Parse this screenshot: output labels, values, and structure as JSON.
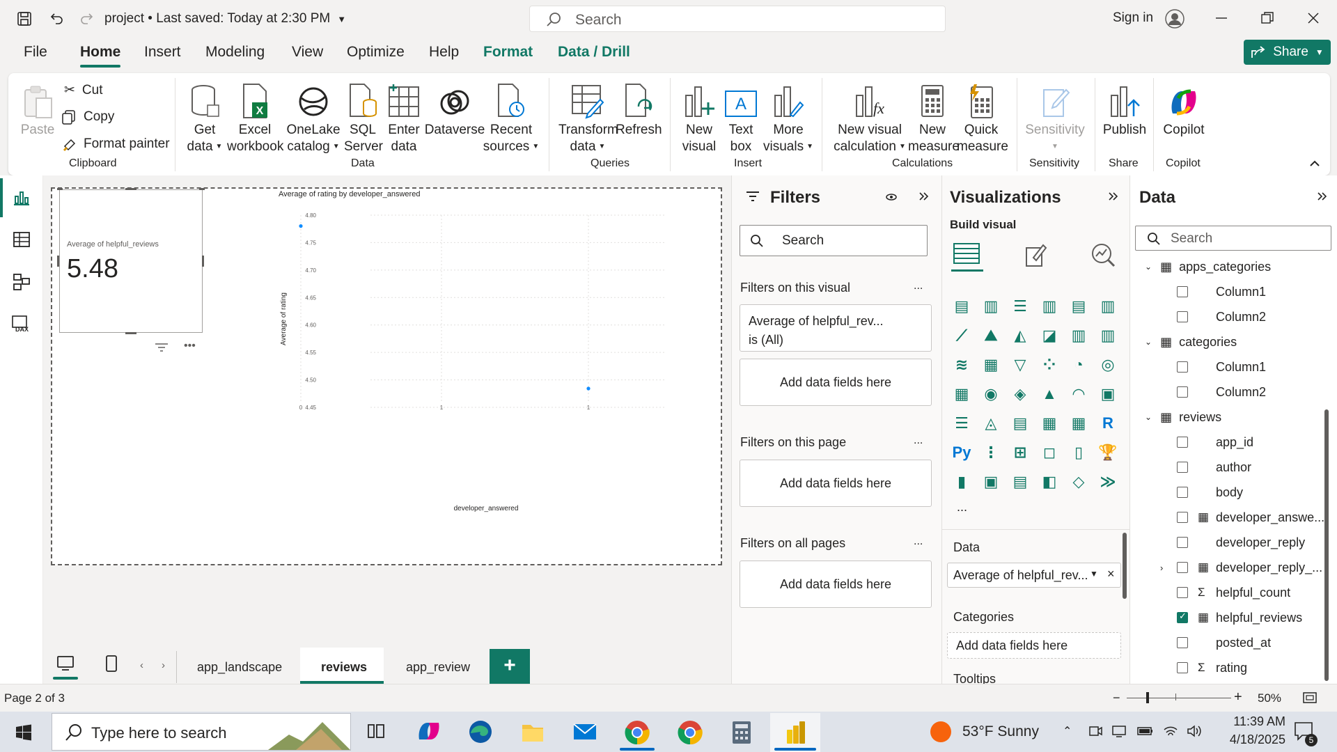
{
  "titlebar": {
    "doc_title": "project • Last saved: Today at 2:30 PM",
    "search_placeholder": "Search",
    "sign_in": "Sign in"
  },
  "menu": {
    "tabs": [
      "File",
      "Home",
      "Insert",
      "Modeling",
      "View",
      "Optimize",
      "Help",
      "Format",
      "Data / Drill"
    ],
    "share": "Share"
  },
  "ribbon": {
    "clipboard": {
      "paste": "Paste",
      "cut": "Cut",
      "copy": "Copy",
      "format_painter": "Format painter",
      "label": "Clipboard"
    },
    "data": {
      "get_data": [
        "Get",
        "data"
      ],
      "excel": [
        "Excel",
        "workbook"
      ],
      "onelake": [
        "OneLake",
        "catalog"
      ],
      "sql": [
        "SQL",
        "Server"
      ],
      "enter": [
        "Enter",
        "data"
      ],
      "dataverse": "Dataverse",
      "recent": [
        "Recent",
        "sources"
      ],
      "label": "Data"
    },
    "queries": {
      "transform": [
        "Transform",
        "data"
      ],
      "refresh": "Refresh",
      "label": "Queries"
    },
    "insert": {
      "new_visual": [
        "New",
        "visual"
      ],
      "text_box": [
        "Text",
        "box"
      ],
      "more_visuals": [
        "More",
        "visuals"
      ],
      "label": "Insert"
    },
    "calculations": {
      "new_visual_calc": [
        "New visual",
        "calculation"
      ],
      "new_measure": [
        "New",
        "measure"
      ],
      "quick_measure": [
        "Quick",
        "measure"
      ],
      "label": "Calculations"
    },
    "sensitivity": {
      "btn": "Sensitivity",
      "label": "Sensitivity"
    },
    "share": {
      "publish": "Publish",
      "label": "Share"
    },
    "copilot": {
      "btn": "Copilot",
      "label": "Copilot"
    }
  },
  "card": {
    "label": "Average of helpful_reviews",
    "value": "5.48"
  },
  "chart_data": {
    "type": "scatter",
    "title": "Average of rating by developer_answered",
    "xlabel": "developer_answered",
    "ylabel": "Average of rating",
    "x_ticks": [
      "0",
      "1",
      "1"
    ],
    "y_ticks": [
      "4.80",
      "4.75",
      "4.70",
      "4.65",
      "4.60",
      "4.55",
      "4.50",
      "4.45"
    ],
    "ylim": [
      4.45,
      4.8
    ],
    "xlim": [
      0,
      1
    ],
    "points": [
      {
        "x": 0,
        "y": 4.79
      },
      {
        "x": 1,
        "y": 4.485
      }
    ],
    "colors": {
      "point": "#118dff"
    }
  },
  "filters": {
    "title": "Filters",
    "search": "Search",
    "on_visual": "Filters on this visual",
    "filter_card_line1": "Average of helpful_rev...",
    "filter_card_line2": "is (All)",
    "add_fields": "Add data fields here",
    "on_page": "Filters on this page",
    "on_all": "Filters on all pages",
    "more": "..."
  },
  "viz": {
    "title": "Visualizations",
    "build": "Build visual",
    "more": "...",
    "data_label": "Data",
    "field": "Average of helpful_rev...",
    "categories_label": "Categories",
    "add_fields": "Add data fields here",
    "tooltips_label": "Tooltips"
  },
  "data_pane": {
    "title": "Data",
    "search": "Search",
    "tables": [
      {
        "name": "apps_categories",
        "fields": [
          "Column1",
          "Column2"
        ]
      },
      {
        "name": "categories",
        "fields": [
          "Column1",
          "Column2"
        ]
      },
      {
        "name": "reviews",
        "fields": [
          "app_id",
          "author",
          "body",
          "developer_answe...",
          "developer_reply",
          "developer_reply_...",
          "helpful_count",
          "helpful_reviews",
          "posted_at",
          "rating"
        ]
      }
    ]
  },
  "pages": {
    "tabs": [
      "app_landscape",
      "reviews",
      "app_review"
    ],
    "active": "reviews",
    "add": "+"
  },
  "status": {
    "page": "Page 2 of 3",
    "zoom": "50%"
  },
  "taskbar": {
    "search": "Type here to search",
    "weather": "53°F  Sunny",
    "time": "11:39 AM",
    "date": "4/18/2025",
    "notif": "5"
  }
}
